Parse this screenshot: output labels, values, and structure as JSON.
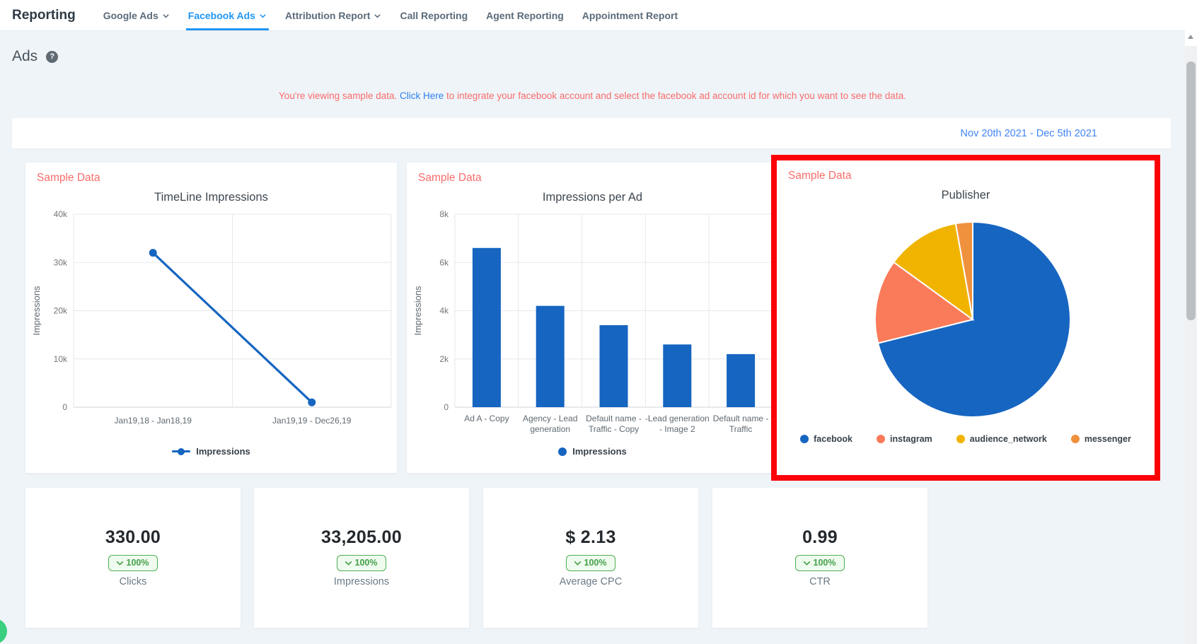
{
  "nav": {
    "title": "Reporting",
    "tabs": [
      {
        "label": "Google Ads"
      },
      {
        "label": "Facebook Ads"
      },
      {
        "label": "Attribution Report"
      },
      {
        "label": "Call Reporting"
      },
      {
        "label": "Agent Reporting"
      },
      {
        "label": "Appointment Report"
      }
    ]
  },
  "page": {
    "heading": "Ads",
    "help_icon": "?",
    "notice": {
      "prefix": "You're viewing sample data.",
      "link": "Click Here",
      "suffix": "to integrate your facebook account and select the facebook ad account id for which you want to see the data."
    },
    "date_range": "Nov 20th 2021 - Dec 5th 2021"
  },
  "sample_badge": "Sample Data",
  "chart_data": [
    {
      "type": "line",
      "title": "TimeLine Impressions",
      "ylabel": "Impressions",
      "categories": [
        "Jan19,18 - Jan18,19",
        "Jan19,19 - Dec26,19"
      ],
      "values": [
        32000,
        1000
      ],
      "ylim": [
        0,
        40000
      ],
      "ytick_step": 10000,
      "legend": "Impressions",
      "color": "#1665c1",
      "grid": true,
      "legend_position": "bottom"
    },
    {
      "type": "bar",
      "title": "Impressions per Ad",
      "ylabel": "Impressions",
      "categories": [
        "Ad A - Copy",
        "Agency - Lead generation",
        "Default name - Traffic - Copy",
        "-Lead generation - Image 2",
        "Default name - Traffic"
      ],
      "label_lines": [
        [
          "Ad A - Copy"
        ],
        [
          "Agency - Lead",
          "generation"
        ],
        [
          "Default name -",
          "Traffic - Copy"
        ],
        [
          "-Lead generation",
          "- Image 2"
        ],
        [
          "Default name -",
          "Traffic"
        ]
      ],
      "values": [
        6600,
        4200,
        3400,
        2600,
        2200
      ],
      "ylim": [
        0,
        8000
      ],
      "ytick_step": 2000,
      "legend": "Impressions",
      "color": "#1665c1",
      "grid": true,
      "legend_position": "bottom"
    },
    {
      "type": "pie",
      "title": "Publisher",
      "slices": [
        {
          "label": "facebook",
          "pct": 71.1,
          "color": "#1665c1"
        },
        {
          "label": "instagram",
          "pct": 13.9,
          "color": "#fa7b5a"
        },
        {
          "label": "audience_network",
          "pct": 12.2,
          "color": "#f0b400"
        },
        {
          "label": "messenger",
          "pct": 2.8,
          "color": "#f0913e"
        }
      ],
      "legend_position": "bottom",
      "highlighted": true
    }
  ],
  "kpis": [
    {
      "value": "330.00",
      "change": "100%",
      "label": "Clicks"
    },
    {
      "value": "33,205.00",
      "change": "100%",
      "label": "Impressions"
    },
    {
      "value": "$ 2.13",
      "change": "100%",
      "label": "Average CPC"
    },
    {
      "value": "0.99",
      "change": "100%",
      "label": "CTR"
    }
  ],
  "colors": {
    "active_tab": "#2196f3",
    "sample_red": "#f86c6b",
    "date_blue": "#4285f4",
    "chart_blue": "#1665c1",
    "badge_green": "#43a047",
    "highlight_red": "#fb0207"
  }
}
